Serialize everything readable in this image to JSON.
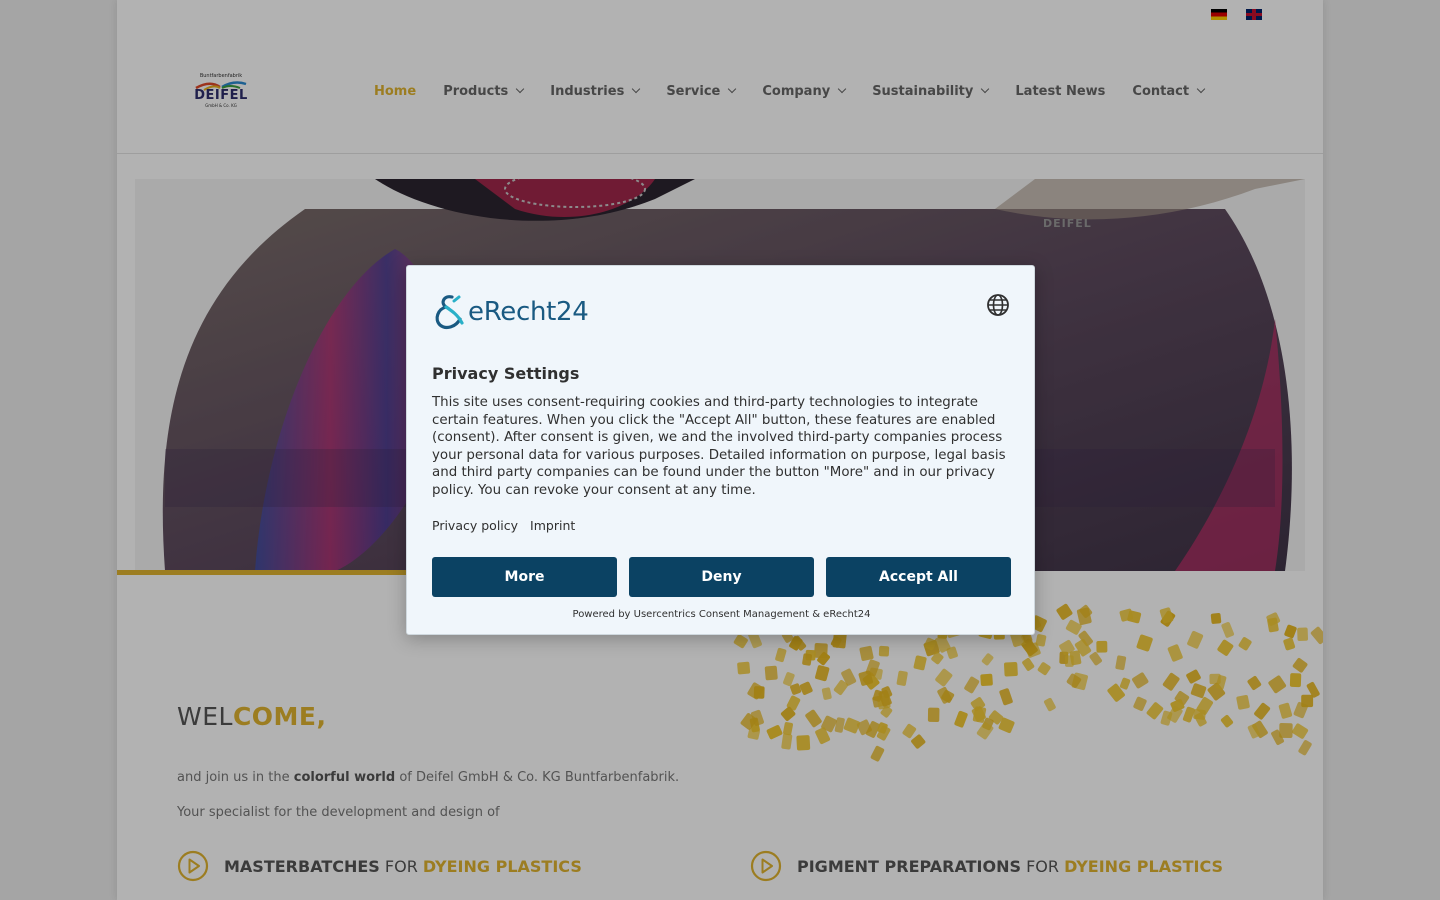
{
  "header": {
    "languages": [
      {
        "code": "de",
        "label": "Deutsch"
      },
      {
        "code": "en",
        "label": "English"
      }
    ],
    "logo": {
      "top_text": "Buntfarbenfabrik",
      "name": "DEIFEL",
      "sub_text": "GmbH & Co. KG"
    },
    "nav": [
      {
        "label": "Home",
        "active": true,
        "dropdown": false
      },
      {
        "label": "Products",
        "active": false,
        "dropdown": true
      },
      {
        "label": "Industries",
        "active": false,
        "dropdown": true
      },
      {
        "label": "Service",
        "active": false,
        "dropdown": true
      },
      {
        "label": "Company",
        "active": false,
        "dropdown": true
      },
      {
        "label": "Sustainability",
        "active": false,
        "dropdown": true
      },
      {
        "label": "Latest News",
        "active": false,
        "dropdown": false
      },
      {
        "label": "Contact",
        "active": false,
        "dropdown": true
      }
    ]
  },
  "hero": {
    "kicker": "DEIFEL"
  },
  "welcome": {
    "title_plain": "WEL",
    "title_accent": "COME,",
    "intro_pre": "and join us in the ",
    "intro_bold": "colorful world",
    "intro_post": " of Deifel GmbH & Co. KG Buntfarbenfabrik.",
    "intro2": "Your specialist for the development and design of",
    "features": [
      {
        "bold": "MASTERBATCHES",
        "mid": " FOR ",
        "accent": "DYEING PLASTICS"
      },
      {
        "bold": "PIGMENT PREPARATIONS",
        "mid": " FOR ",
        "accent": "DYEING PLASTICS"
      }
    ]
  },
  "consent": {
    "brand": "eRecht24",
    "title": "Privacy Settings",
    "body": "This site uses consent-requiring cookies and third-party technologies to integrate certain features. When you click the \"Accept All\" button, these features are enabled (consent). After consent is given, we and the involved third-party companies process your personal data for various purposes. Detailed information on purpose, legal basis and third party companies can be found under the button \"More\" and in our privacy policy. You can revoke your consent at any time.",
    "links": {
      "privacy": "Privacy policy",
      "imprint": "Imprint"
    },
    "buttons": {
      "more": "More",
      "deny": "Deny",
      "accept": "Accept All"
    },
    "powered": "Powered by Usercentrics Consent Management & eRecht24"
  },
  "colors": {
    "accent": "#e0b430",
    "consent_button": "#0b4263",
    "brand_blue": "#1a5a82",
    "nav_text": "#666666"
  },
  "icons": [
    "flag-de-icon",
    "flag-en-icon",
    "chevron-down-icon",
    "play-circle-icon",
    "globe-icon",
    "erecht24-logo-icon"
  ]
}
